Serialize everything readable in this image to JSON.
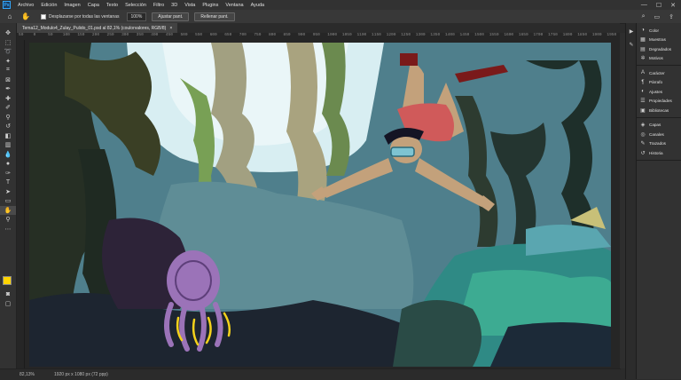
{
  "app": {
    "logo": "Ps"
  },
  "menu": [
    "Archivo",
    "Edición",
    "Imagen",
    "Capa",
    "Texto",
    "Selección",
    "Filtro",
    "3D",
    "Vista",
    "Plugins",
    "Ventana",
    "Ayuda"
  ],
  "window_controls": [
    "—",
    "☐",
    "✕"
  ],
  "options": {
    "scroll_all_label": "Desplazarse por todas las ventanas",
    "zoom_value": "100%",
    "fit_button": "Ajustar pant.",
    "fill_button": "Rellenar pant."
  },
  "document": {
    "tab_title": "Tema12_Modulo4_Zulay_Pulido_01.psd al 82,1% (coulorvalores, RGB/8)",
    "close": "×"
  },
  "rulers": {
    "top_labels": [
      "50",
      "0",
      "50",
      "100",
      "150",
      "200",
      "250",
      "300",
      "350",
      "400",
      "450",
      "500",
      "550",
      "600",
      "650",
      "700",
      "750",
      "800",
      "850",
      "900",
      "950",
      "1000",
      "1050",
      "1100",
      "1150",
      "1200",
      "1250",
      "1300",
      "1350",
      "1400",
      "1450",
      "1500",
      "1550",
      "1600",
      "1650",
      "1700",
      "1750",
      "1800",
      "1850",
      "1900",
      "1950"
    ]
  },
  "status": {
    "zoom": "82,13%",
    "info": "1920 px x 1080 px (72 ppp)"
  },
  "panels": {
    "group1": [
      {
        "icon": "◑",
        "label": "Color"
      },
      {
        "icon": "▦",
        "label": "Muestras"
      },
      {
        "icon": "▤",
        "label": "Degradados"
      },
      {
        "icon": "✲",
        "label": "Motivos"
      }
    ],
    "group2": [
      {
        "icon": "A",
        "label": "Carácter"
      },
      {
        "icon": "¶",
        "label": "Párrafo"
      },
      {
        "icon": "◐",
        "label": "Ajustes"
      },
      {
        "icon": "☰",
        "label": "Propiedades"
      },
      {
        "icon": "▣",
        "label": "Bibliotecas"
      }
    ],
    "group3": [
      {
        "icon": "◈",
        "label": "Capas"
      },
      {
        "icon": "◎",
        "label": "Canales"
      },
      {
        "icon": "✎",
        "label": "Trazados"
      },
      {
        "icon": "↺",
        "label": "Historia"
      }
    ]
  },
  "colors": {
    "foreground": "#ffd400",
    "background": "#1a1a1a",
    "accent": "#31a8ff"
  }
}
